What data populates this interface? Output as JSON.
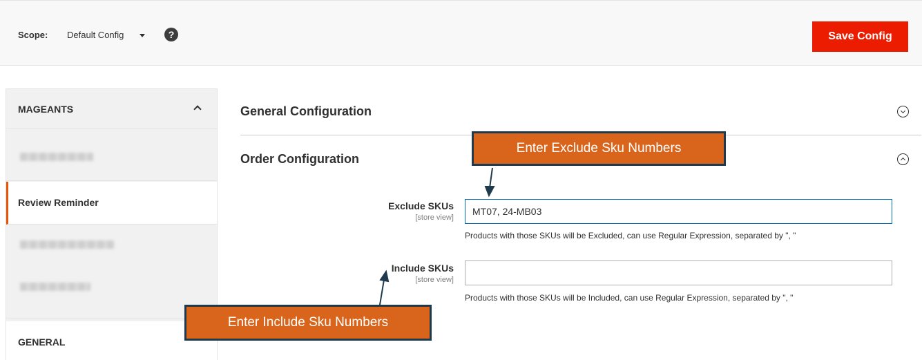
{
  "scope_bar": {
    "label": "Scope:",
    "value": "Default Config",
    "help_icon": "question-icon",
    "save_label": "Save Config"
  },
  "sidebar": {
    "group_title": "MAGEANTS",
    "active_item": "Review Reminder",
    "general_title": "GENERAL"
  },
  "main": {
    "sections": [
      {
        "title": "General Configuration",
        "state": "collapsed"
      },
      {
        "title": "Order Configuration",
        "state": "expanded"
      }
    ],
    "fields": [
      {
        "label": "Exclude SKUs",
        "scope": "[store view]",
        "value": "MT07, 24-MB03",
        "note": "Products with those SKUs will be Excluded, can use Regular Expression, separated by \", \""
      },
      {
        "label": "Include SKUs",
        "scope": "[store view]",
        "value": "",
        "note": "Products with those SKUs will be Included, can use Regular Expression, separated by \", \""
      }
    ]
  },
  "annotations": {
    "exclude": "Enter Exclude Sku Numbers",
    "include": "Enter Include Sku Numbers"
  },
  "colors": {
    "accent": "#eb1c00",
    "active_border": "#eb5202",
    "callout_fill": "#d9651c",
    "callout_border": "#1f3a4d",
    "focus_border": "#006bb4"
  }
}
